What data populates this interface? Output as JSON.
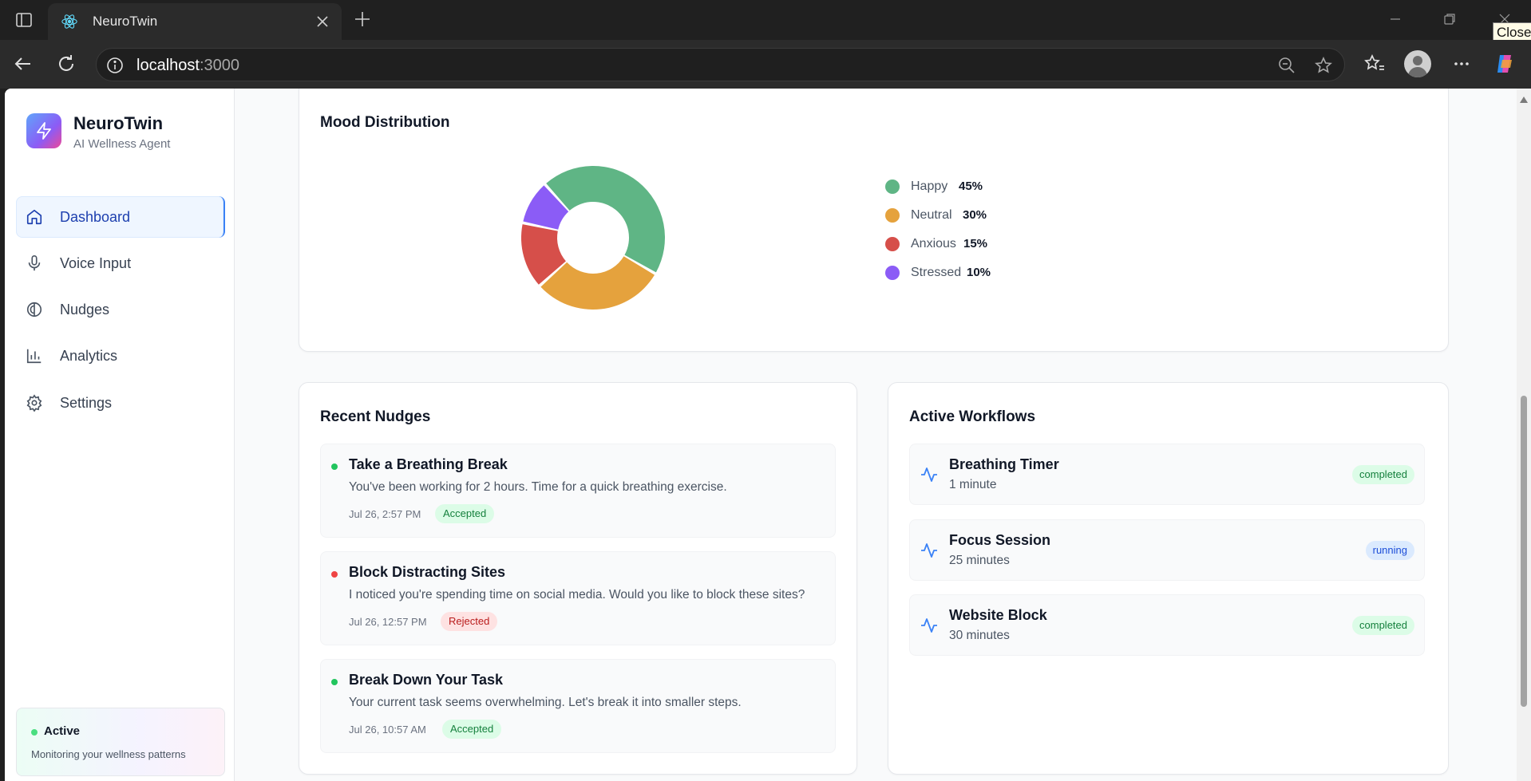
{
  "browser": {
    "tab_title": "NeuroTwin",
    "url_host": "localhost",
    "url_port": ":3000",
    "tooltip": "Close"
  },
  "sidebar": {
    "brand": "NeuroTwin",
    "brand_sub": "AI Wellness Agent",
    "items": [
      {
        "label": "Dashboard",
        "icon": "home-icon",
        "active": true
      },
      {
        "label": "Voice Input",
        "icon": "microphone-icon",
        "active": false
      },
      {
        "label": "Nudges",
        "icon": "brain-icon",
        "active": false
      },
      {
        "label": "Analytics",
        "icon": "bar-chart-icon",
        "active": false
      },
      {
        "label": "Settings",
        "icon": "gear-icon",
        "active": false
      }
    ],
    "status": {
      "title": "Active",
      "desc": "Monitoring your wellness patterns"
    }
  },
  "mood": {
    "title": "Mood Distribution",
    "chart_data": {
      "type": "pie",
      "categories": [
        "Happy",
        "Neutral",
        "Anxious",
        "Stressed"
      ],
      "values": [
        45,
        30,
        15,
        10
      ],
      "labels": [
        "45%",
        "30%",
        "15%",
        "10%"
      ],
      "colors": [
        "#5fb585",
        "#e5a23d",
        "#d64f4a",
        "#8b5cf6"
      ],
      "legend_position": "right"
    }
  },
  "nudges": {
    "title": "Recent Nudges",
    "items": [
      {
        "title": "Take a Breathing Break",
        "message": "You've been working for 2 hours. Time for a quick breathing exercise.",
        "time": "Jul 26, 2:57 PM",
        "status": "Accepted",
        "dot": "#22c55e"
      },
      {
        "title": "Block Distracting Sites",
        "message": "I noticed you're spending time on social media. Would you like to block these sites?",
        "time": "Jul 26, 12:57 PM",
        "status": "Rejected",
        "dot": "#ef4444"
      },
      {
        "title": "Break Down Your Task",
        "message": "Your current task seems overwhelming. Let's break it into smaller steps.",
        "time": "Jul 26, 10:57 AM",
        "status": "Accepted",
        "dot": "#22c55e"
      }
    ]
  },
  "workflows": {
    "title": "Active Workflows",
    "items": [
      {
        "name": "Breathing Timer",
        "duration": "1 minute",
        "status": "completed"
      },
      {
        "name": "Focus Session",
        "duration": "25 minutes",
        "status": "running"
      },
      {
        "name": "Website Block",
        "duration": "30 minutes",
        "status": "completed"
      }
    ]
  }
}
